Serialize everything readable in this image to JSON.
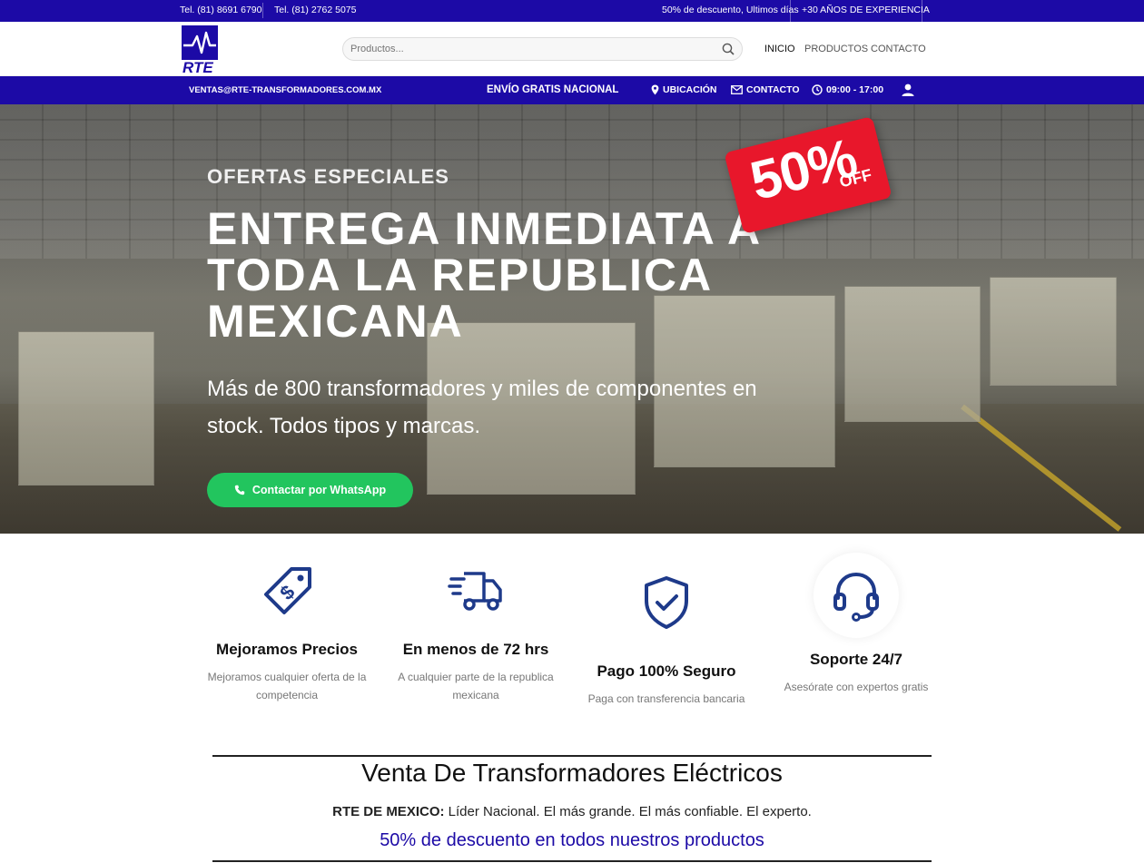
{
  "topbar": {
    "phone1": "Tel. (81) 8691 6790",
    "phone2": "Tel. (81) 2762 5075",
    "promo": "50% de descuento, Ultimos días",
    "experience": "+30 AÑOS DE EXPERIENCIA"
  },
  "header": {
    "logo_text": "RTE",
    "search_placeholder": "Productos...",
    "nav": [
      "INICIO",
      "PRODUCTOS",
      "CONTACTO"
    ]
  },
  "infobar": {
    "email": "VENTAS@RTE-TRANSFORMADORES.COM.MX",
    "shipping": "ENVÍO GRATIS NACIONAL",
    "location": "UBICACIÓN",
    "contact": "CONTACTO",
    "hours": "09:00 - 17:00"
  },
  "hero": {
    "subtitle": "OFERTAS ESPECIALES",
    "title": "ENTREGA INMEDIATA A TODA LA REPUBLICA MEXICANA",
    "description": "Más de 800 transformadores y miles de componentes en stock. Todos tipos y marcas.",
    "cta": "Contactar por WhatsApp",
    "badge_percent": "50%",
    "badge_off": "OFF"
  },
  "features": [
    {
      "icon": "price-tag-icon",
      "title": "Mejoramos Precios",
      "text": "Mejoramos cualquier oferta de la competencia"
    },
    {
      "icon": "delivery-truck-icon",
      "title": "En menos  de  72 hrs",
      "text": "A cualquier parte  de  la republica mexicana"
    },
    {
      "icon": "shield-check-icon",
      "title": "Pago 100% Seguro",
      "text": "Paga con transferencia bancaria"
    },
    {
      "icon": "headset-icon",
      "title": "Soporte 24/7",
      "text": "Asesórate con expertos gratis"
    }
  ],
  "section": {
    "title": "Venta De Transformadores Eléctricos",
    "company": "RTE DE MEXICO:",
    "tagline": " Líder Nacional.  El más grande.  El más confiable.  El experto.",
    "promo": "50% de descuento en todos nuestros productos"
  },
  "colors": {
    "brand": "#1c0aa6",
    "whatsapp": "#22c55e",
    "badge": "#e8172b"
  }
}
